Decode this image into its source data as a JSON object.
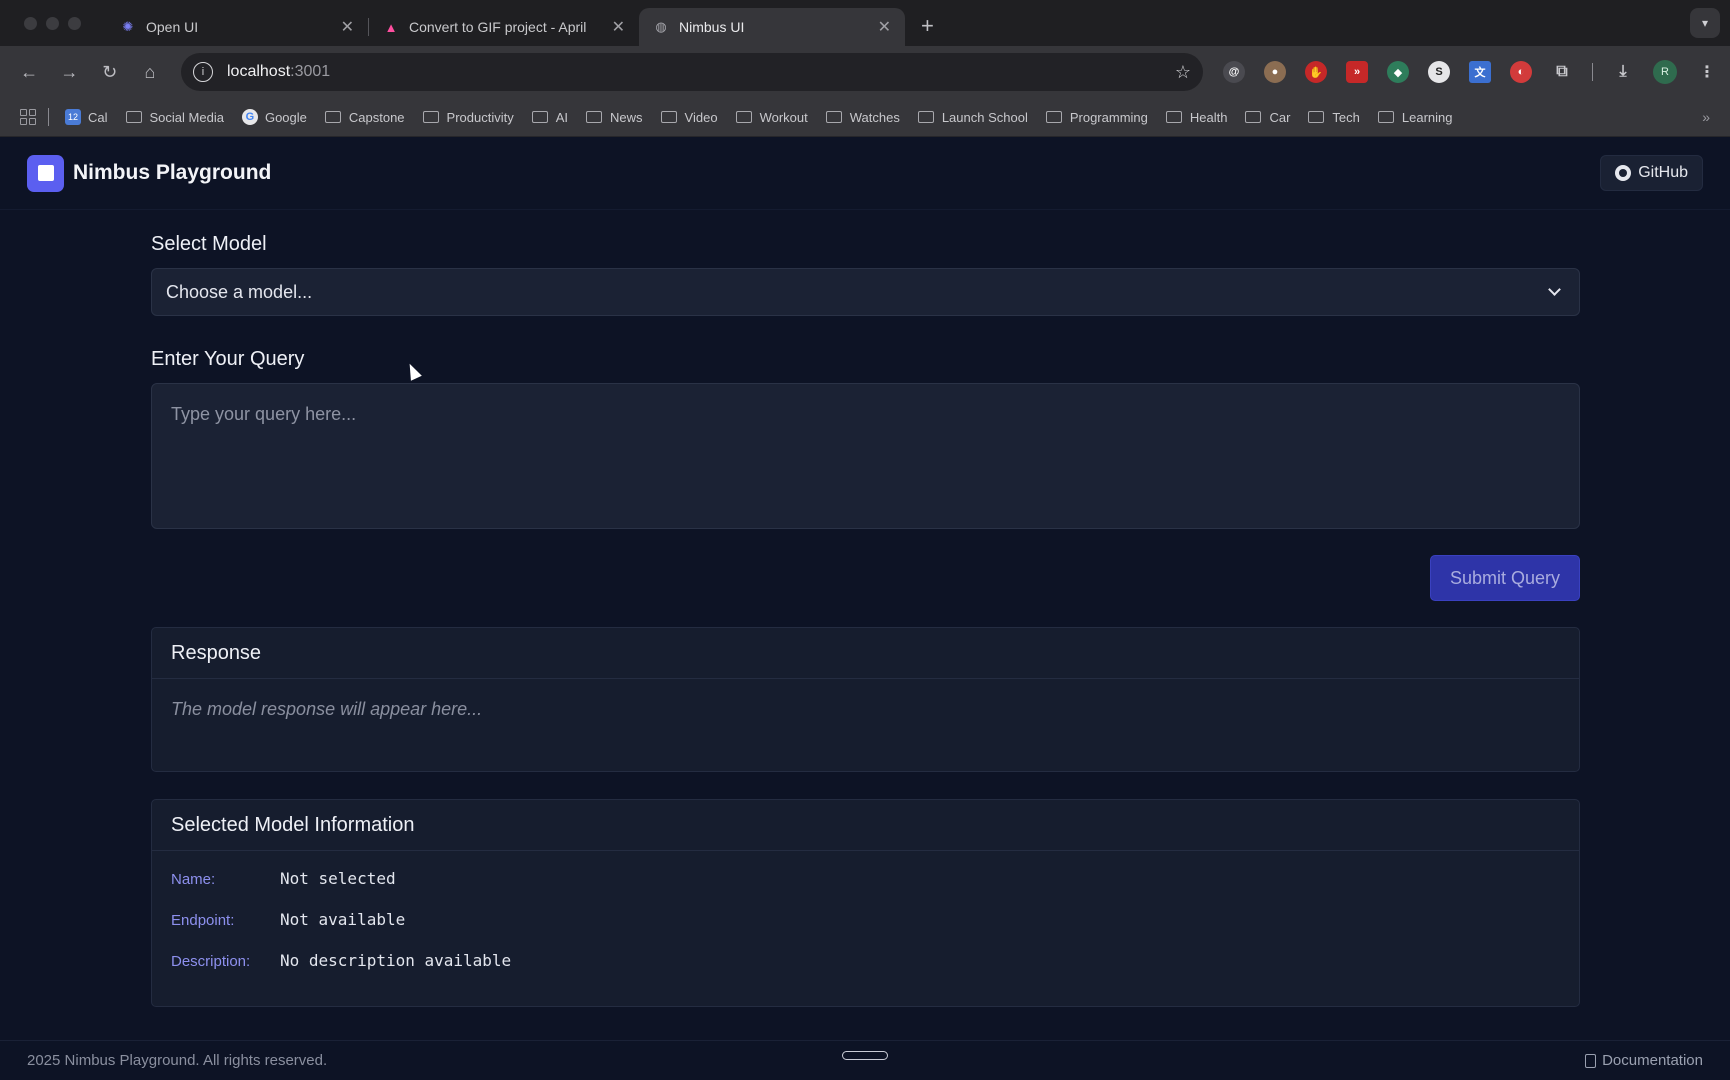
{
  "browser": {
    "tabs": [
      {
        "title": "Open UI",
        "icon": "gear-flower-icon"
      },
      {
        "title": "Convert to GIF project - April",
        "icon": "triangle-logo-icon"
      },
      {
        "title": "Nimbus UI",
        "icon": "globe-icon"
      }
    ],
    "url_host": "localhost",
    "url_port": ":3001",
    "bookmarks": [
      "Cal",
      "Social Media",
      "Google",
      "Capstone",
      "Productivity",
      "AI",
      "News",
      "Video",
      "Workout",
      "Watches",
      "Launch School",
      "Programming",
      "Health",
      "Car",
      "Tech",
      "Learning"
    ],
    "profile_initial": "R"
  },
  "app": {
    "brand": "Nimbus Playground",
    "github_label": "GitHub",
    "select_label": "Select Model",
    "select_value": "Choose a model...",
    "query_label": "Enter Your Query",
    "query_placeholder": "Type your query here...",
    "submit_label": "Submit Query",
    "response_title": "Response",
    "response_placeholder": "The model response will appear here...",
    "info_title": "Selected Model Information",
    "info": [
      {
        "key": "Name:",
        "value": "Not selected"
      },
      {
        "key": "Endpoint:",
        "value": "Not available"
      },
      {
        "key": "Description:",
        "value": "No description available"
      }
    ],
    "footer_text": "2025 Nimbus Playground. All rights reserved.",
    "footer_link": "Documentation"
  },
  "colors": {
    "accent": "#5b5ff0",
    "submit_bg": "#2e34a8",
    "info_key": "#8d90ee"
  }
}
